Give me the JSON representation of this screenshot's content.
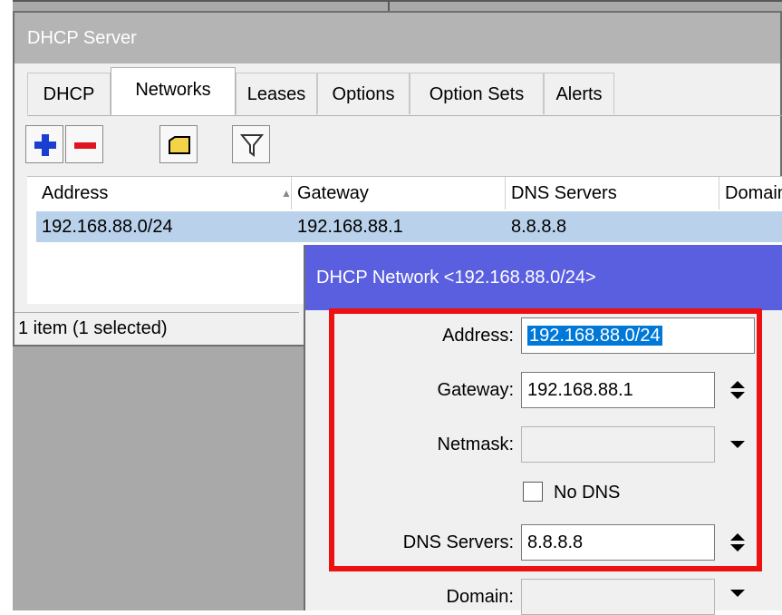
{
  "server_window": {
    "title": "DHCP Server",
    "tabs": [
      "DHCP",
      "Networks",
      "Leases",
      "Options",
      "Option Sets",
      "Alerts"
    ],
    "active_tab": "Networks",
    "toolbar": [
      "add-icon",
      "remove-icon",
      "comment-icon",
      "filter-icon"
    ],
    "columns": [
      "Address",
      "Gateway",
      "DNS Servers",
      "Domain"
    ],
    "rows": [
      {
        "address": "192.168.88.0/24",
        "gateway": "192.168.88.1",
        "dns": "8.8.8.8",
        "domain": ""
      }
    ],
    "status": "1 item (1 selected)"
  },
  "network_dialog": {
    "title": "DHCP Network <192.168.88.0/24>",
    "address_label": "Address:",
    "address_value": "192.168.88.0/24",
    "gateway_label": "Gateway:",
    "gateway_value": "192.168.88.1",
    "netmask_label": "Netmask:",
    "netmask_value": "",
    "no_dns_label": "No DNS",
    "no_dns_checked": false,
    "dns_label": "DNS Servers:",
    "dns_value": "8.8.8.8",
    "domain_label": "Domain:",
    "domain_value": ""
  },
  "colors": {
    "dialog_title_bg": "#5a5fe0",
    "selection": "#b9d1ea",
    "highlight_border": "#ee1111"
  }
}
